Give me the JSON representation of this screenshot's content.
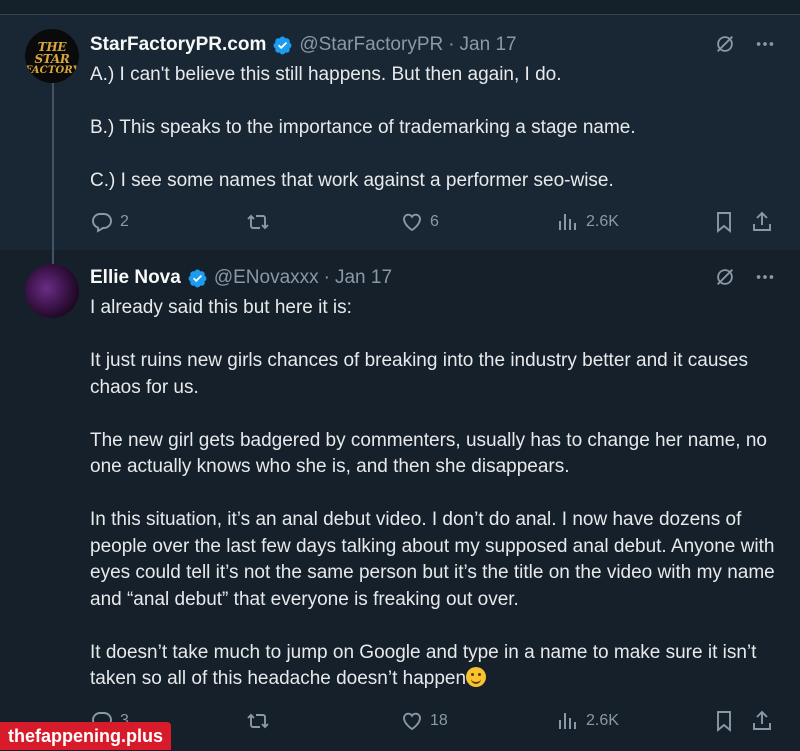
{
  "tweets": [
    {
      "name": "StarFactoryPR.com",
      "handle": "@StarFactoryPR",
      "date": "Jan 17",
      "avatar_text": [
        "THE STAR",
        "FACTORY"
      ],
      "paragraphs": [
        "A.) I can't believe this still happens. But then again, I do.",
        "B.) This speaks to the importance of trademarking a stage name.",
        "C.) I see some names that work against a performer seo-wise."
      ],
      "replies": "2",
      "reposts": "",
      "likes": "6",
      "views": "2.6K"
    },
    {
      "name": "Ellie Nova",
      "handle": "@ENovaxxx",
      "date": "Jan 17",
      "paragraphs": [
        "I already said this but here it is:",
        "It just ruins new girls chances of breaking into the industry better and it causes chaos for us.",
        "The new girl gets badgered by commenters, usually has to change her name, no one actually knows who she is, and then she disappears.",
        "In this situation, it’s an anal debut video. I don’t do anal. I now have dozens of people over the last few days talking about my supposed anal debut. Anyone with eyes could tell it’s not the same person but it’s the title on the video with my name and “anal debut” that everyone is freaking out over.",
        "It doesn’t take much to jump on Google and type in a name to make sure it isn’t taken so all of this headache doesn’t happen"
      ],
      "replies": "3",
      "reposts": "",
      "likes": "18",
      "views": "2.6K"
    }
  ],
  "watermark": "thefappening.plus",
  "colors": {
    "background": "#15202b",
    "highlight_background": "#192734",
    "secondary_text": "#8b98a5",
    "verified_blue": "#1d9bf0",
    "watermark_red": "#d81b2a"
  },
  "icons": [
    "verified-badge-icon",
    "grok-icon",
    "more-icon",
    "reply-icon",
    "repost-icon",
    "like-icon",
    "views-icon",
    "bookmark-icon",
    "share-icon"
  ]
}
